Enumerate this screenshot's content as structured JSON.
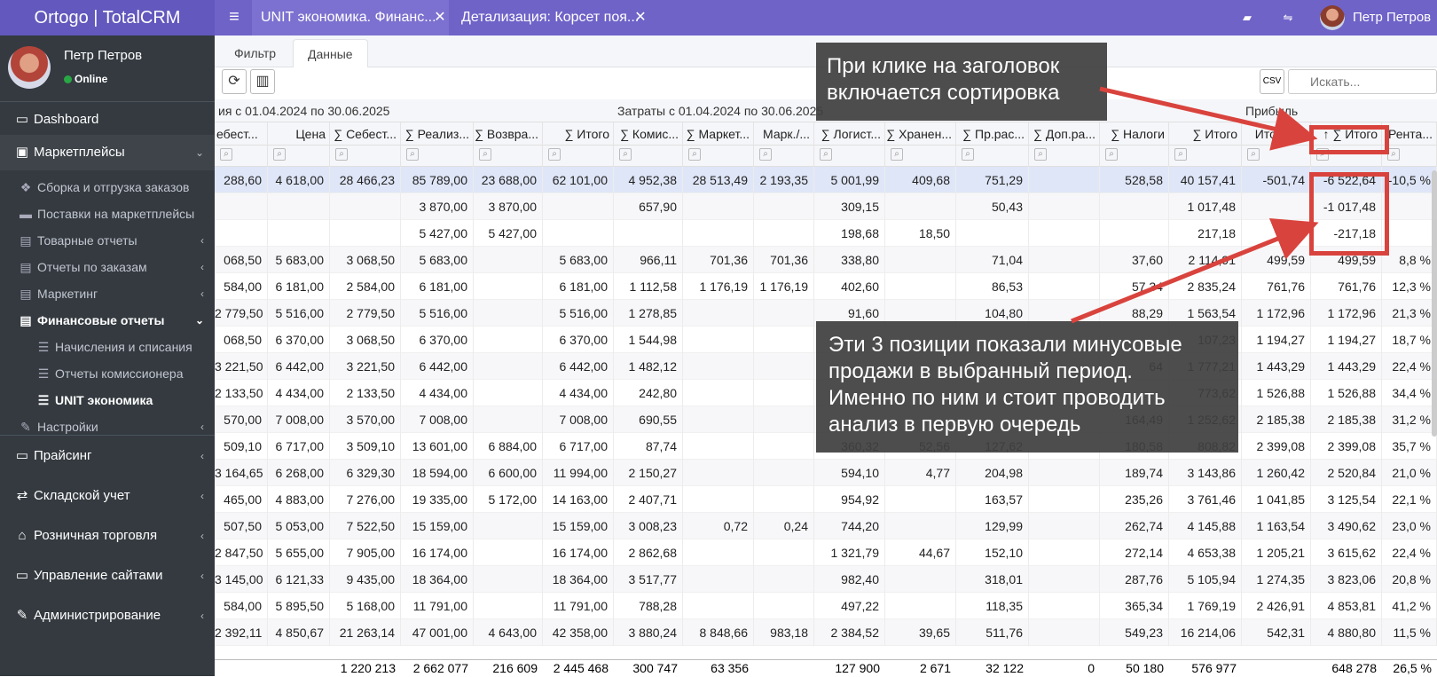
{
  "topbar": {
    "brand": "Ortogo | TotalCRM",
    "tabs": [
      {
        "label": "UNIT экономика. Финанс..."
      },
      {
        "label": "Детализация: Корсет поя..."
      }
    ],
    "user_name": "Петр Петров"
  },
  "sidebar": {
    "user_name": "Петр Петров",
    "status": "Online",
    "items": [
      {
        "label": "Dashboard",
        "icon": "monitor-icon"
      },
      {
        "label": "Маркетплейсы",
        "icon": "shopping-bag-icon"
      },
      {
        "label": "Сборка и отгрузка заказов",
        "icon": "dropbox-icon"
      },
      {
        "label": "Поставки на маркетплейсы",
        "icon": "archive-icon"
      },
      {
        "label": "Товарные отчеты",
        "icon": "table-icon"
      },
      {
        "label": "Отчеты по заказам",
        "icon": "table-icon"
      },
      {
        "label": "Маркетинг",
        "icon": "table-icon"
      },
      {
        "label": "Финансовые отчеты",
        "icon": "table-icon"
      },
      {
        "label": "Начисления и списания",
        "icon": "list-icon"
      },
      {
        "label": "Отчеты комиссионера",
        "icon": "list-icon"
      },
      {
        "label": "UNIT экономика",
        "icon": "list-icon"
      },
      {
        "label": "Настройки",
        "icon": "wrench-icon"
      },
      {
        "label": "Прайсинг",
        "icon": "credit-card-icon"
      },
      {
        "label": "Складской учет",
        "icon": "exchange-icon"
      },
      {
        "label": "Розничная торговля",
        "icon": "bank-icon"
      },
      {
        "label": "Управление сайтами",
        "icon": "desktop-icon"
      },
      {
        "label": "Администрирование",
        "icon": "wrench-icon"
      }
    ]
  },
  "page_tabs": {
    "filter": "Фильтр",
    "data": "Данные"
  },
  "search": {
    "placeholder": "Искать..."
  },
  "groups": {
    "sales": "ия с 01.04.2024 по 30.06.2025",
    "costs": "Затраты с 01.04.2024 по 30.06.2025",
    "profit": "Прибыль"
  },
  "columns": [
    "ебест...",
    "Цена",
    "∑ Себест...",
    "∑ Реализ...",
    "∑ Возвра...",
    "∑ Итого",
    "∑ Комис...",
    "∑ Маркет...",
    "Марк./...",
    "∑ Логист...",
    "∑ Хранен...",
    "∑ Пр.рас...",
    "∑ Доп.ра...",
    "∑ Налоги",
    "∑ Итого",
    "Итого шт",
    "∑ Итого",
    "Рента..."
  ],
  "rows": [
    [
      "288,60",
      "4 618,00",
      "28 466,23",
      "85 789,00",
      "23 688,00",
      "62 101,00",
      "4 952,38",
      "28 513,49",
      "2 193,35",
      "5 001,99",
      "409,68",
      "751,29",
      "",
      "528,58",
      "40 157,41",
      "-501,74",
      "-6 522,64",
      "-10,5 %"
    ],
    [
      "",
      "",
      "",
      "3 870,00",
      "3 870,00",
      "",
      "657,90",
      "",
      "",
      "309,15",
      "",
      "50,43",
      "",
      "",
      "1 017,48",
      "",
      "-1 017,48",
      ""
    ],
    [
      "",
      "",
      "",
      "5 427,00",
      "5 427,00",
      "",
      "",
      "",
      "",
      "198,68",
      "18,50",
      "",
      "",
      "",
      "217,18",
      "",
      "-217,18",
      ""
    ],
    [
      "068,50",
      "5 683,00",
      "3 068,50",
      "5 683,00",
      "",
      "5 683,00",
      "966,11",
      "701,36",
      "701,36",
      "338,80",
      "",
      "71,04",
      "",
      "37,60",
      "2 114,91",
      "499,59",
      "499,59",
      "8,8 %"
    ],
    [
      "584,00",
      "6 181,00",
      "2 584,00",
      "6 181,00",
      "",
      "6 181,00",
      "1 112,58",
      "1 176,19",
      "1 176,19",
      "402,60",
      "",
      "86,53",
      "",
      "57,34",
      "2 835,24",
      "761,76",
      "761,76",
      "12,3 %"
    ],
    [
      "2 779,50",
      "5 516,00",
      "2 779,50",
      "5 516,00",
      "",
      "5 516,00",
      "1 278,85",
      "",
      "",
      "91,60",
      "",
      "104,80",
      "",
      "88,29",
      "1 563,54",
      "1 172,96",
      "1 172,96",
      "21,3 %"
    ],
    [
      "068,50",
      "6 370,00",
      "3 068,50",
      "6 370,00",
      "",
      "6 370,00",
      "1 544,98",
      "",
      "",
      "",
      "",
      "",
      "",
      "",
      "107,23",
      "1 194,27",
      "1 194,27",
      "18,7 %"
    ],
    [
      "3 221,50",
      "6 442,00",
      "3 221,50",
      "6 442,00",
      "",
      "6 442,00",
      "1 482,12",
      "",
      "",
      "",
      "",
      "",
      "",
      "64",
      "1 777,21",
      "1 443,29",
      "1 443,29",
      "22,4 %"
    ],
    [
      "2 133,50",
      "4 434,00",
      "2 133,50",
      "4 434,00",
      "",
      "4 434,00",
      "242,80",
      "",
      "",
      "",
      "",
      "",
      "",
      "",
      "773,62",
      "1 526,88",
      "1 526,88",
      "34,4 %"
    ],
    [
      "570,00",
      "7 008,00",
      "3 570,00",
      "7 008,00",
      "",
      "7 008,00",
      "690,55",
      "",
      "",
      "",
      "",
      "",
      "",
      "164,49",
      "1 252,62",
      "2 185,38",
      "2 185,38",
      "31,2 %"
    ],
    [
      "509,10",
      "6 717,00",
      "3 509,10",
      "13 601,00",
      "6 884,00",
      "6 717,00",
      "87,74",
      "",
      "",
      "360,32",
      "52,56",
      "127,62",
      "",
      "180,58",
      "808,82",
      "2 399,08",
      "2 399,08",
      "35,7 %"
    ],
    [
      "3 164,65",
      "6 268,00",
      "6 329,30",
      "18 594,00",
      "6 600,00",
      "11 994,00",
      "2 150,27",
      "",
      "",
      "594,10",
      "4,77",
      "204,98",
      "",
      "189,74",
      "3 143,86",
      "1 260,42",
      "2 520,84",
      "21,0 %"
    ],
    [
      "465,00",
      "4 883,00",
      "7 276,00",
      "19 335,00",
      "5 172,00",
      "14 163,00",
      "2 407,71",
      "",
      "",
      "954,92",
      "",
      "163,57",
      "",
      "235,26",
      "3 761,46",
      "1 041,85",
      "3 125,54",
      "22,1 %"
    ],
    [
      "507,50",
      "5 053,00",
      "7 522,50",
      "15 159,00",
      "",
      "15 159,00",
      "3 008,23",
      "0,72",
      "0,24",
      "744,20",
      "",
      "129,99",
      "",
      "262,74",
      "4 145,88",
      "1 163,54",
      "3 490,62",
      "23,0 %"
    ],
    [
      "2 847,50",
      "5 655,00",
      "7 905,00",
      "16 174,00",
      "",
      "16 174,00",
      "2 862,68",
      "",
      "",
      "1 321,79",
      "44,67",
      "152,10",
      "",
      "272,14",
      "4 653,38",
      "1 205,21",
      "3 615,62",
      "22,4 %"
    ],
    [
      "3 145,00",
      "6 121,33",
      "9 435,00",
      "18 364,00",
      "",
      "18 364,00",
      "3 517,77",
      "",
      "",
      "982,40",
      "",
      "318,01",
      "",
      "287,76",
      "5 105,94",
      "1 274,35",
      "3 823,06",
      "20,8 %"
    ],
    [
      "584,00",
      "5 895,50",
      "5 168,00",
      "11 791,00",
      "",
      "11 791,00",
      "788,28",
      "",
      "",
      "497,22",
      "",
      "118,35",
      "",
      "365,34",
      "1 769,19",
      "2 426,91",
      "4 853,81",
      "41,2 %"
    ],
    [
      "2 392,11",
      "4 850,67",
      "21 263,14",
      "47 001,00",
      "4 643,00",
      "42 358,00",
      "3 880,24",
      "8 848,66",
      "983,18",
      "2 384,52",
      "39,65",
      "511,76",
      "",
      "549,23",
      "16 214,06",
      "542,31",
      "4 880,80",
      "11,5 %"
    ]
  ],
  "totals": [
    "",
    "",
    "1 220 213",
    "2 662 077",
    "216 609",
    "2 445 468",
    "300 747",
    "63 356",
    "",
    "127 900",
    "2 671",
    "32 122",
    "0",
    "50 180",
    "576 977",
    "",
    "648 278",
    "26,5 %"
  ],
  "callouts": {
    "sort_line1": "При клике на заголовок",
    "sort_line2": "включается сортировка",
    "neg_line1": "Эти 3 позиции показали минусовые",
    "neg_line2": "продажи в выбранный период.",
    "neg_line3": "Именно по ним и стоит проводить",
    "neg_line4": "анализ в первую очередь"
  },
  "colors": {
    "accent": "#6f63c8",
    "sidebar": "#343a40",
    "annotation": "#d9433d"
  }
}
